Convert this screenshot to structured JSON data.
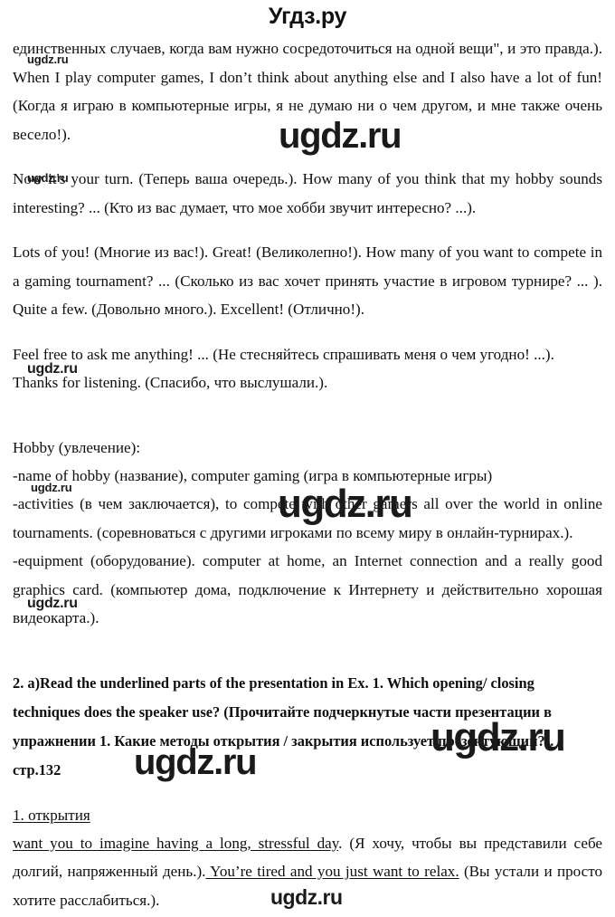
{
  "site": {
    "header_logo": "Угдз.ру",
    "footer_logo": "ugdz.ru",
    "watermark_text": "ugdz.ru"
  },
  "document": {
    "paragraphs": [
      {
        "id": "p1",
        "text": "единственных случаев, когда вам нужно сосредоточиться на одной вещи\", и это правда.). When I play computer games, I don’t think about anything else and I also have a lot of fun! (Когда я играю в компьютерные игры, я не думаю ни о чем другом, и мне также очень весело!)."
      },
      {
        "id": "p2",
        "text": "Now it's your turn. (Теперь ваша очередь.). How many of you think that my hobby sounds interesting? ... (Кто из вас думает, что мое хобби звучит интересно? ...)."
      },
      {
        "id": "p3",
        "text": "Lots of you! (Многие из вас!). Great! (Великолепно!). How many of you want to compete in a gaming tournament? ... (Сколько из вас хочет принять участие в игровом турнире? ... ). Quite a few. (Довольно много.). Excellent! (Отлично!)."
      },
      {
        "id": "p4",
        "text": "Feel free to ask me anything! ... (Не стесняйтесь спрашивать меня о чем угодно! ...). Thanks for listening. (Спасибо, что выслушали.)."
      }
    ],
    "hobby_block": {
      "heading": "Hobby (увлечение):",
      "lines": [
        "-name of hobby (название), computer gaming (игра в компьютерные игры)",
        "-activities (в чем заключается), to compete with other gamers all over the world in online tournaments. (соревноваться с другими игроками по всему миру в онлайн-турнирах.).",
        "-equipment (оборудование). computer at home, an Internet connection and a really good graphics card. (компьютер дома, подключение к Интернету и действительно хорошая видеокарта.)."
      ]
    },
    "task2": {
      "prompt": "2. a)Read the underlined parts of the presentation in Ex. 1. Which opening/ closing techniques does the speaker use? (Прочитайте подчеркнутые части презентации в упражнении 1. Какие методы открытия / закрытия использует презентующий?). стр.132",
      "answer_label": "1. открытия",
      "answer_underlined_1": "want you to imagine having a long, stressful day",
      "answer_plain_1": ". (Я хочу, чтобы вы представили себе долгий, напряженный день.).",
      "answer_underlined_2": " You’re tired and you just want to relax.",
      "answer_plain_2": " (Вы устали и просто хотите расслабиться.)."
    }
  },
  "colors": {
    "text": "#100f0f",
    "background": "#ffffff",
    "watermark": "#1a1a1a"
  }
}
